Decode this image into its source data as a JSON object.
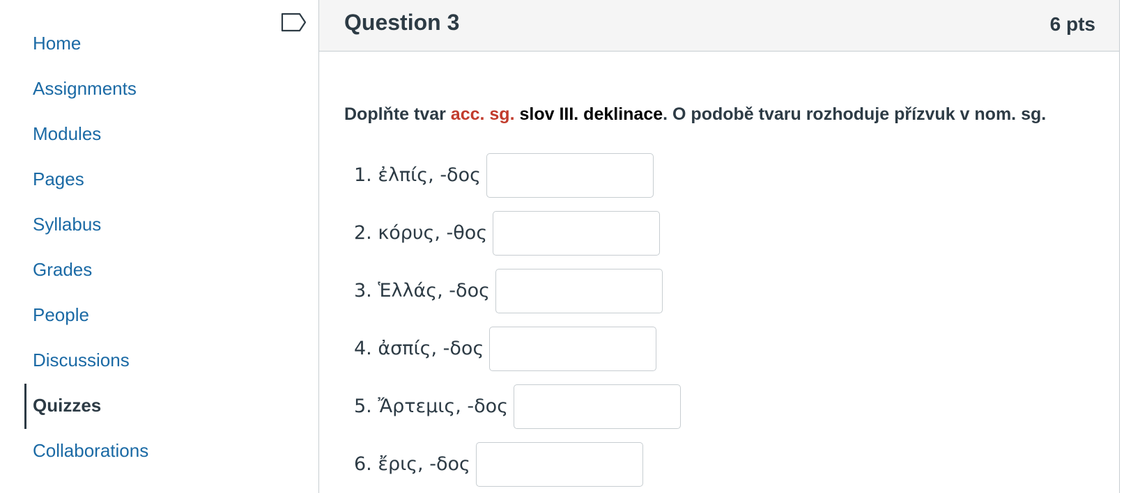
{
  "sidebar": {
    "items": [
      {
        "label": "Home"
      },
      {
        "label": "Assignments"
      },
      {
        "label": "Modules"
      },
      {
        "label": "Pages"
      },
      {
        "label": "Syllabus"
      },
      {
        "label": "Grades"
      },
      {
        "label": "People"
      },
      {
        "label": "Discussions"
      },
      {
        "label": "Quizzes",
        "active": true
      },
      {
        "label": "Collaborations"
      }
    ],
    "flag_icon": "flag-outline-icon"
  },
  "question": {
    "title": "Question 3",
    "points": "6 pts",
    "text": {
      "part1": "Doplňte tvar ",
      "highlight": "acc. sg.",
      "part2": " slov III. deklinace",
      "part3": ". O podobě tvaru rozhoduje přízvuk v nom. sg."
    },
    "items": [
      {
        "label": "1. ἐλπίς, -δος",
        "value": ""
      },
      {
        "label": "2. κόρυς, -θος",
        "value": ""
      },
      {
        "label": "3. Ἑλλάς, -δος",
        "value": ""
      },
      {
        "label": "4. ἀσπίς, -δος",
        "value": ""
      },
      {
        "label": "5. Ἄρτεμις, -δος",
        "value": ""
      },
      {
        "label": "6. ἔρις, -δος",
        "value": ""
      }
    ]
  },
  "colors": {
    "link": "#1b6aa5",
    "text": "#2d3b45",
    "highlight": "#c23c2d",
    "border": "#c7cdd1",
    "header_bg": "#f5f5f5"
  }
}
